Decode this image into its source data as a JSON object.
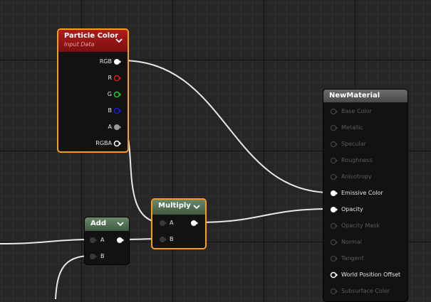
{
  "particle_color": {
    "title": "Particle Color",
    "subtitle": "Input Data",
    "pins": [
      "RGB",
      "R",
      "G",
      "B",
      "A",
      "RGBA"
    ]
  },
  "multiply": {
    "title": "Multiply",
    "inputs": [
      "A",
      "B"
    ]
  },
  "add": {
    "title": "Add",
    "inputs": [
      "A",
      "B"
    ]
  },
  "material": {
    "title": "NewMaterial",
    "pins": [
      {
        "label": "Base Color",
        "active": false
      },
      {
        "label": "Metallic",
        "active": false
      },
      {
        "label": "Specular",
        "active": false
      },
      {
        "label": "Roughness",
        "active": false
      },
      {
        "label": "Anisotropy",
        "active": false
      },
      {
        "label": "Emissive Color",
        "active": true
      },
      {
        "label": "Opacity",
        "active": true
      },
      {
        "label": "Opacity Mask",
        "active": false
      },
      {
        "label": "Normal",
        "active": false
      },
      {
        "label": "Tangent",
        "active": false
      },
      {
        "label": "World Position Offset",
        "active": true
      },
      {
        "label": "Subsurface Color",
        "active": false
      }
    ]
  },
  "colors": {
    "particle_header": "#8a1414",
    "math_header": "#5c7a5c",
    "material_header": "#5a5a5a",
    "selection": "#f59d1c",
    "pin_r": "#e01b1b",
    "pin_g": "#1bd11b",
    "pin_b": "#1b1be0",
    "wire": "#e8e8e8"
  }
}
